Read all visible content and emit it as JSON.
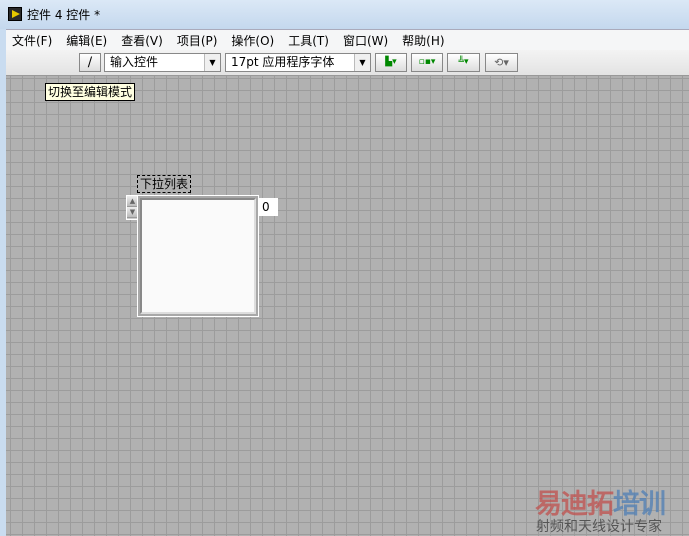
{
  "window": {
    "title": "控件 4 控件 *"
  },
  "menu": [
    "文件(F)",
    "编辑(E)",
    "查看(V)",
    "项目(P)",
    "操作(O)",
    "工具(T)",
    "窗口(W)",
    "帮助(H)"
  ],
  "toolbar": {
    "control_type": "输入控件",
    "font": "17pt 应用程序字体"
  },
  "tooltip": "切换至编辑模式",
  "listbox": {
    "label": "下拉列表",
    "index": "0"
  },
  "watermark": {
    "brand_red": "易迪拓",
    "brand_blue": "培训",
    "tagline": "射频和天线设计专家",
    "red": "#c0504d",
    "blue": "#4f7fb5"
  }
}
